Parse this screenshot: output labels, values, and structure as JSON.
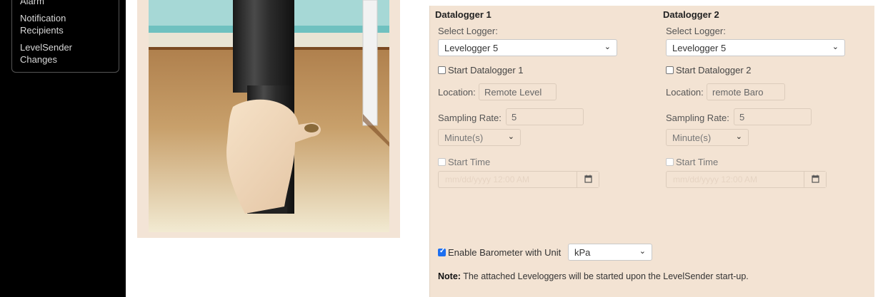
{
  "sidebar": {
    "items": [
      {
        "label": "Alarm"
      },
      {
        "label": "Notification"
      },
      {
        "label": "Recipients"
      },
      {
        "label": "LevelSender"
      },
      {
        "label": "Changes"
      }
    ]
  },
  "dataloggers": [
    {
      "heading": "Datalogger 1",
      "select_label": "Select Logger:",
      "logger": "Levelogger 5",
      "start_label": "Start Datalogger 1",
      "location_label": "Location:",
      "location_value": "Remote Level",
      "sampling_label": "Sampling Rate:",
      "sampling_value": "5",
      "unit": "Minute(s)",
      "start_time_label": "Start Time",
      "date_placeholder": "mm/dd/yyyy 12:00 AM"
    },
    {
      "heading": "Datalogger 2",
      "select_label": "Select Logger:",
      "logger": "Levelogger 5",
      "start_label": "Start Datalogger 2",
      "location_label": "Location:",
      "location_value": "remote Baro",
      "sampling_label": "Sampling Rate:",
      "sampling_value": "5",
      "unit": "Minute(s)",
      "start_time_label": "Start Time",
      "date_placeholder": "mm/dd/yyyy 12:00 AM"
    }
  ],
  "barometer": {
    "label": "Enable Barometer with Unit",
    "unit": "kPa",
    "checked": true
  },
  "note": {
    "prefix": "Note:",
    "text": " The attached Leveloggers will be started upon the LevelSender start-up."
  },
  "colors": {
    "panel_bg": "#f3e3d3",
    "sidebar_bg": "#000000",
    "checkbox_accent": "#1d6ff0"
  }
}
